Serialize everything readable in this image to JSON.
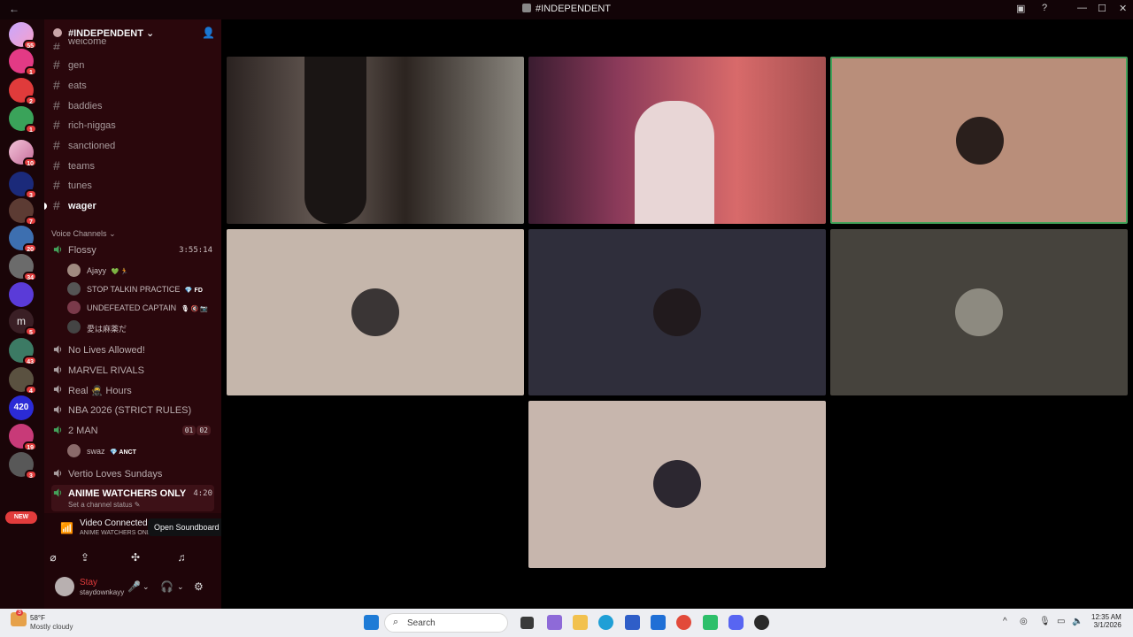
{
  "window": {
    "title": "#INDEPENDENT"
  },
  "server": {
    "name": "#INDEPENDENT",
    "name_suffix": "⌄",
    "server_badges": [
      "55",
      "1",
      "2",
      "1",
      "10",
      "3",
      "7",
      "20",
      "34",
      "",
      "5",
      "43",
      "4",
      "",
      "19",
      "3"
    ],
    "new_label": "NEW"
  },
  "text_channels": [
    {
      "name": "welcome",
      "partial": true
    },
    {
      "name": "gen"
    },
    {
      "name": "eats"
    },
    {
      "name": "baddies"
    },
    {
      "name": "rich-niggas"
    },
    {
      "name": "sanctioned"
    },
    {
      "name": "teams"
    },
    {
      "name": "tunes"
    },
    {
      "name": "wager",
      "unread": true
    }
  ],
  "voice_category": "Voice Channels",
  "voice_channels": {
    "flossy": {
      "name": "Flossy",
      "time": "3:55:14"
    },
    "flossy_users": [
      {
        "name": "Ajayy",
        "tag": "💚 🏃"
      },
      {
        "name": "STOP TALKIN PRACTICE",
        "tag": "💎 FD"
      },
      {
        "name": "UNDEFEATED CAPTAIN",
        "tag": "🎙 🔇 📷"
      },
      {
        "name": "愛は麻薬だ",
        "tag": ""
      }
    ],
    "others": [
      "No Lives Allowed!",
      "MARVEL RIVALS",
      "Real 🥷 Hours",
      "NBA 2026 (STRICT RULES)"
    ],
    "two_man": {
      "name": "2 MAN",
      "count_a": "01",
      "count_b": "02"
    },
    "two_man_users": [
      {
        "name": "swaz",
        "tag": "💎 ANCT"
      }
    ],
    "vertio": "Vertio Loves Sundays",
    "anime": {
      "name": "ANIME WATCHERS ONLY",
      "time": "4:20",
      "status": "Set a channel status ✎"
    }
  },
  "voice_panel": {
    "status": "Video Connected",
    "path": "ANIME WATCHERS ONLY / #INDEPENDENT",
    "tooltip": "Open Soundboard"
  },
  "user": {
    "display_name": "Stay",
    "username": "staydownkayy"
  },
  "taskbar": {
    "temperature": "58°F",
    "condition": "Mostly cloudy",
    "weather_badge": "3",
    "search_placeholder": "Search",
    "time": "12:35 AM",
    "date": "3/1/2026"
  },
  "colors": {
    "accent_red": "#e23c3c",
    "speaking_green": "#43a25a",
    "channel_bg": "#2a070c"
  }
}
